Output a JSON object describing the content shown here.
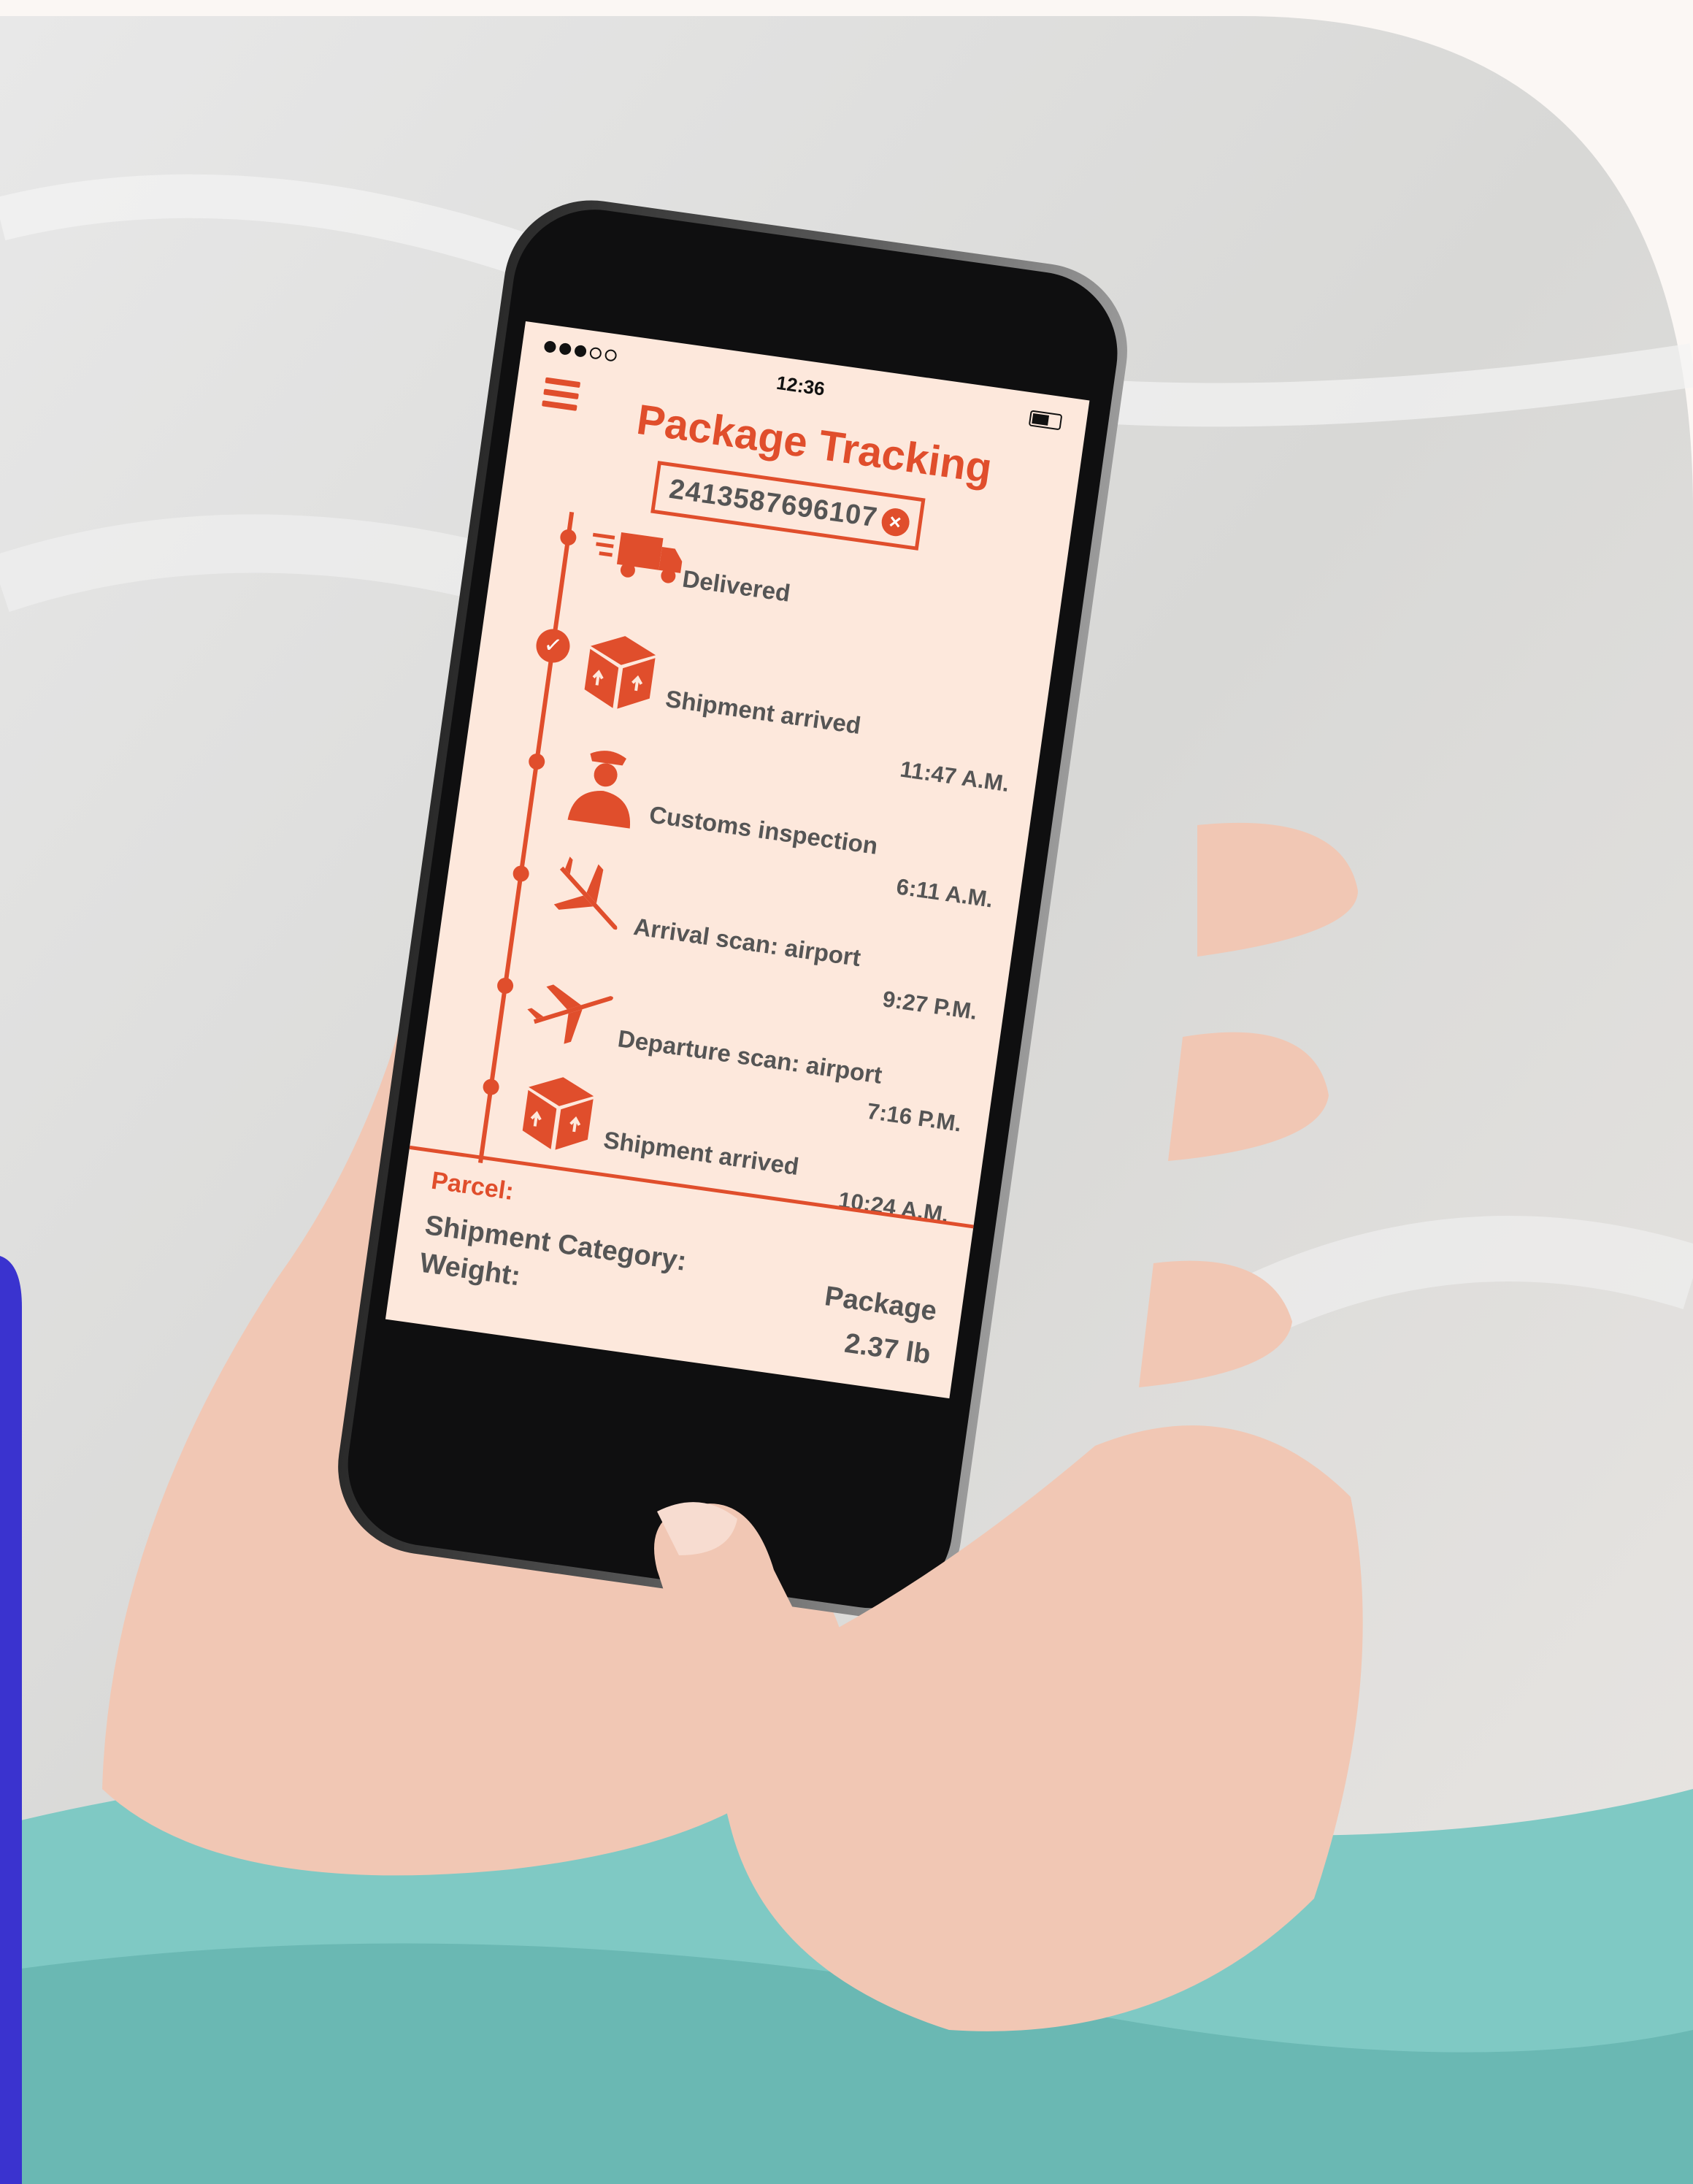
{
  "status_bar": {
    "time": "12:36"
  },
  "app": {
    "title": "Package Tracking",
    "tracking_number": "2413587696107"
  },
  "events": [
    {
      "icon": "truck-icon",
      "label": "Delivered",
      "time": ""
    },
    {
      "icon": "box-icon",
      "label": "Shipment arrived",
      "time": "11:47 A.M."
    },
    {
      "icon": "customs-officer-icon",
      "label": "Customs inspection",
      "time": "6:11 A.M."
    },
    {
      "icon": "plane-landing-icon",
      "label": "Arrival scan: airport",
      "time": "9:27 P.M."
    },
    {
      "icon": "plane-takeoff-icon",
      "label": "Departure scan: airport",
      "time": "7:16 P.M."
    },
    {
      "icon": "box-icon",
      "label": "Shipment arrived",
      "time": "10:24 A.M."
    }
  ],
  "parcel": {
    "heading": "Parcel:",
    "category_label": "Shipment Category:",
    "category_value": "Package",
    "weight_label": "Weight:",
    "weight_value": "2.37 lb"
  },
  "colors": {
    "accent": "#e04e2c",
    "screen_bg": "#fde8dc",
    "text_gray": "#555555",
    "side_band": "#3a33cf",
    "sweater": "#7fc9c4",
    "skin": "#f1c7b4"
  }
}
